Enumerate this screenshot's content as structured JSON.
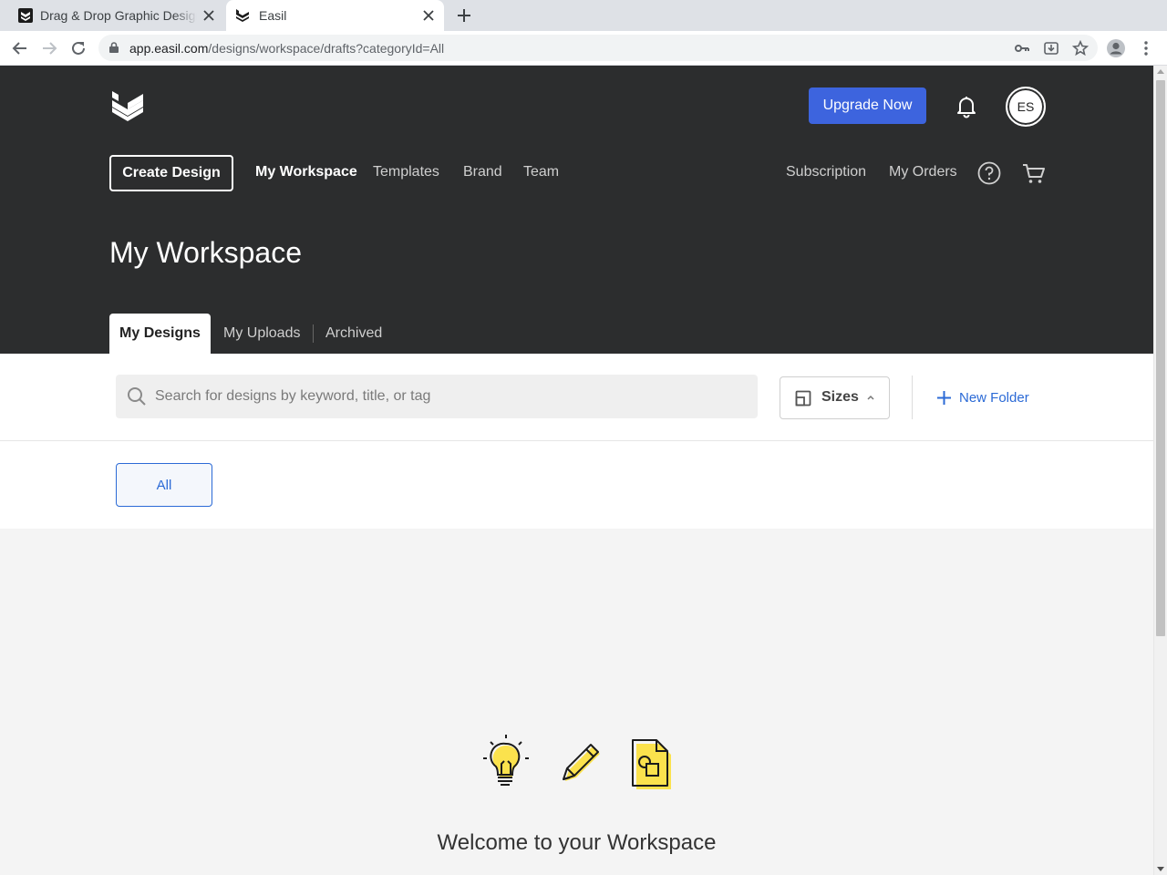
{
  "browser": {
    "tabs": [
      {
        "title": "Drag & Drop Graphic Design"
      },
      {
        "title": "Easil"
      }
    ],
    "url_host": "app.easil.com",
    "url_path": "/designs/workspace/drafts?categoryId=All"
  },
  "header": {
    "upgrade_label": "Upgrade Now",
    "avatar_initials": "ES",
    "create_label": "Create Design",
    "nav": {
      "my_workspace": "My Workspace",
      "templates": "Templates",
      "brand": "Brand",
      "team": "Team",
      "subscription": "Subscription",
      "my_orders": "My Orders"
    },
    "title": "My Workspace",
    "subtabs": {
      "my_designs": "My Designs",
      "my_uploads": "My Uploads",
      "archived": "Archived"
    }
  },
  "filters": {
    "search_placeholder": "Search for designs by keyword, title, or tag",
    "search_value": "",
    "sizes_label": "Sizes",
    "new_folder_label": "New Folder",
    "category_selected": "All"
  },
  "empty_state": {
    "heading": "Welcome to your Workspace"
  },
  "colors": {
    "header_bg": "#2c2d2e",
    "accent": "#3d64de",
    "link": "#2b6ad6",
    "illustration_yellow": "#fbe24d"
  },
  "icons": [
    "lock-icon",
    "back-icon",
    "forward-icon",
    "reload-icon",
    "key-icon",
    "install-icon",
    "star-icon",
    "profile-icon",
    "menu-icon",
    "bell-icon",
    "help-icon",
    "cart-icon",
    "search-icon",
    "size-icon",
    "plus-icon",
    "lightbulb-icon",
    "pencil-icon",
    "document-icon"
  ]
}
